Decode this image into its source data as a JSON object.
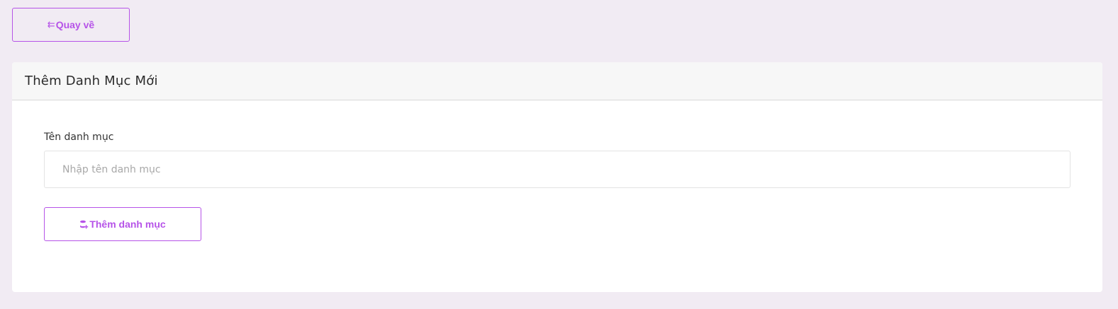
{
  "header": {
    "back_label": "Quay về",
    "back_icon": "arrow-left-icon"
  },
  "card": {
    "title": "Thêm Danh Mục Mới",
    "field_label": "Tên danh mục",
    "input_value": "",
    "input_placeholder": "Nhập tên danh mục",
    "submit_label": "Thêm danh mục",
    "submit_icon": "database-plus-icon"
  },
  "colors": {
    "accent": "#b653e8",
    "background": "#f1ebf3",
    "card_header_bg": "#f7f7f7",
    "card_bg": "#ffffff"
  }
}
